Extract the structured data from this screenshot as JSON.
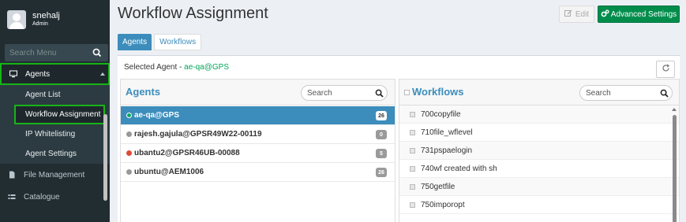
{
  "sidebar": {
    "user": {
      "name": "snehalj",
      "role": "Admin"
    },
    "search": {
      "placeholder": "Search Menu"
    },
    "items": [
      {
        "label": "Agents",
        "icon": "monitor-icon",
        "active": true
      },
      {
        "label": "File Management",
        "icon": "file-icon"
      },
      {
        "label": "Catalogue",
        "icon": "list-icon"
      }
    ],
    "subitems": [
      {
        "label": "Agent List"
      },
      {
        "label": "Workflow Assignment",
        "active": true
      },
      {
        "label": "IP Whitelisting"
      },
      {
        "label": "Agent Settings"
      }
    ]
  },
  "header": {
    "title": "Workflow Assignment",
    "edit_label": "Edit",
    "advanced_label": "Advanced Settings"
  },
  "tabs": [
    {
      "label": "Agents",
      "active": true
    },
    {
      "label": "Workflows",
      "active": false
    }
  ],
  "selected_agent": {
    "prefix": "Selected Agent - ",
    "value": "ae-qa@GPS"
  },
  "agents_panel": {
    "title": "Agents",
    "search_placeholder": "Search",
    "rows": [
      {
        "name": "ae-qa@GPS",
        "count": "26",
        "status_color": "#00a65a",
        "selected": true
      },
      {
        "name": "rajesh.gajula@GPSR49W22-00119",
        "count": "0",
        "status_color": "#999999"
      },
      {
        "name": "ubantu2@GPSR46UB-00088",
        "count": "5",
        "status_color": "#dd4b39"
      },
      {
        "name": "ubuntu@AEM1006",
        "count": "26",
        "status_color": "#999999"
      }
    ]
  },
  "workflows_panel": {
    "title": "Workflows",
    "search_placeholder": "Search",
    "rows": [
      {
        "name": "700copyfile"
      },
      {
        "name": "710file_wflevel"
      },
      {
        "name": "731pspaelogin"
      },
      {
        "name": "740wf created with sh"
      },
      {
        "name": "750getfile"
      },
      {
        "name": "750imporopt"
      }
    ]
  },
  "colors": {
    "sidebar_bg": "#222d32",
    "accent_blue": "#3c8dbc",
    "success_green": "#008d4c",
    "highlight_border": "#17b417"
  }
}
